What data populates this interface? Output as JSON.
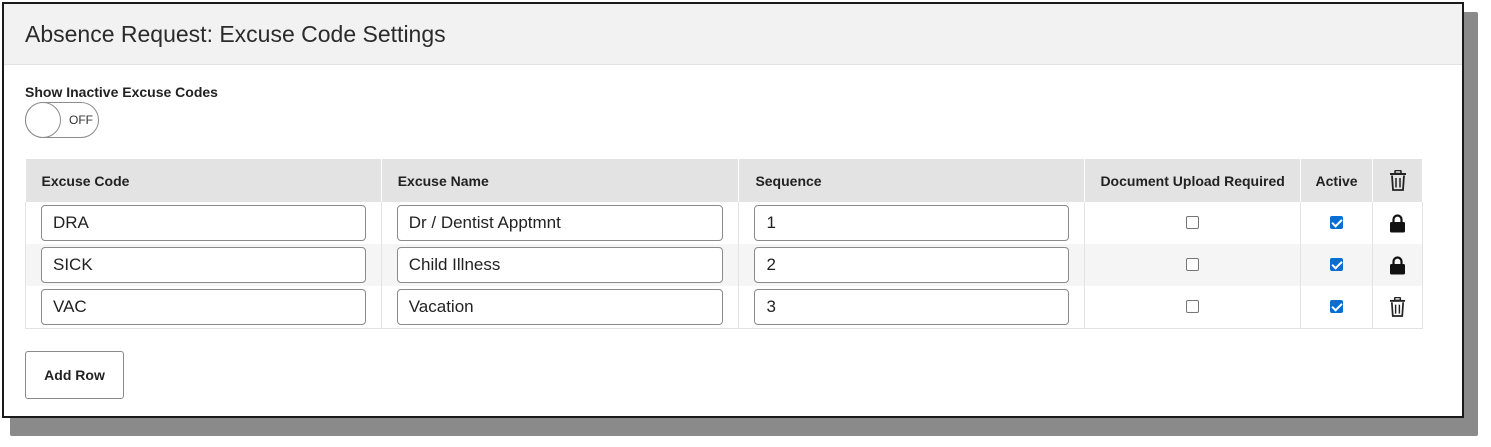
{
  "header": {
    "title": "Absence Request: Excuse Code Settings"
  },
  "toggle": {
    "label": "Show Inactive Excuse Codes",
    "state_text": "OFF",
    "on": false
  },
  "table": {
    "columns": [
      "Excuse Code",
      "Excuse Name",
      "Sequence",
      "Document Upload Required",
      "Active"
    ],
    "header_action_icon": "trash-icon",
    "rows": [
      {
        "code": "DRA",
        "name": "Dr / Dentist Apptmnt",
        "sequence": "1",
        "document_upload_required": false,
        "active": true,
        "action_icon": "lock-icon"
      },
      {
        "code": "SICK",
        "name": "Child Illness",
        "sequence": "2",
        "document_upload_required": false,
        "active": true,
        "action_icon": "lock-icon"
      },
      {
        "code": "VAC",
        "name": "Vacation",
        "sequence": "3",
        "document_upload_required": false,
        "active": true,
        "action_icon": "trash-icon"
      }
    ]
  },
  "add_row_button": {
    "label": "Add Row"
  },
  "colors": {
    "checkbox_checked": "#0a6ed1",
    "header_bg": "#f2f2f2",
    "table_header_bg": "#e3e3e3"
  }
}
